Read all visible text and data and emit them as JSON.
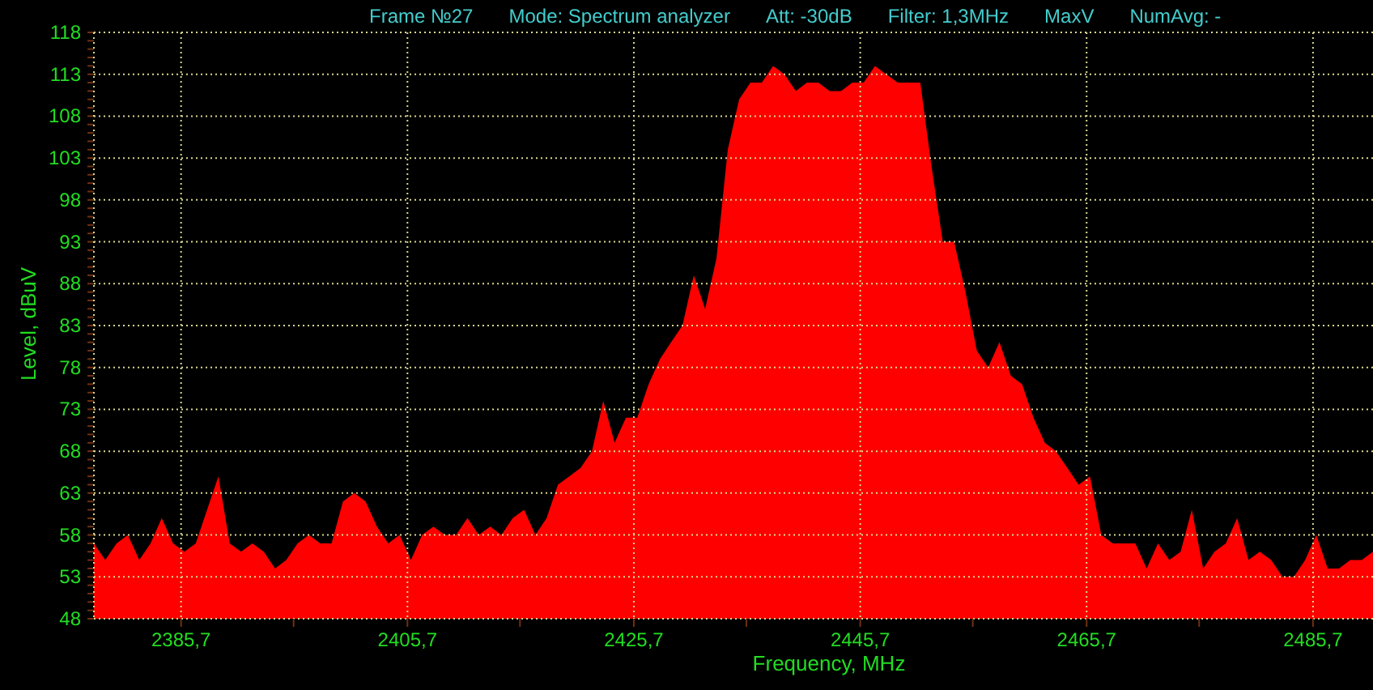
{
  "header": [
    {
      "text": "Frame №27"
    },
    {
      "text": "Mode: Spectrum analyzer"
    },
    {
      "text": "Att: -30dB"
    },
    {
      "text": "Filter: 1,3MHz"
    },
    {
      "text": "MaxV"
    },
    {
      "text": "NumAvg: -"
    }
  ],
  "chart_data": {
    "type": "area",
    "xlabel": "Frequency, MHz",
    "ylabel": "Level, dBuV",
    "grid": true,
    "xlim": [
      2378,
      2491
    ],
    "ylim": [
      48,
      118
    ],
    "xticks": [
      {
        "value": 2385.7,
        "label": "2385,7"
      },
      {
        "value": 2405.7,
        "label": "2405,7"
      },
      {
        "value": 2425.7,
        "label": "2425,7"
      },
      {
        "value": 2445.7,
        "label": "2445,7"
      },
      {
        "value": 2465.7,
        "label": "2465,7"
      },
      {
        "value": 2485.7,
        "label": "2485,7"
      }
    ],
    "yticks": [
      48,
      53,
      58,
      63,
      68,
      73,
      78,
      83,
      88,
      93,
      98,
      103,
      108,
      113,
      118
    ],
    "x": [
      2378,
      2379,
      2380,
      2381,
      2382,
      2383,
      2384,
      2385,
      2386,
      2387,
      2388,
      2389,
      2390,
      2391,
      2392,
      2393,
      2394,
      2395,
      2396,
      2397,
      2398,
      2399,
      2400,
      2401,
      2402,
      2403,
      2404,
      2405,
      2406,
      2407,
      2408,
      2409,
      2410,
      2411,
      2412,
      2413,
      2414,
      2415,
      2416,
      2417,
      2418,
      2419,
      2420,
      2421,
      2422,
      2423,
      2424,
      2425,
      2426,
      2427,
      2428,
      2429,
      2430,
      2431,
      2432,
      2433,
      2434,
      2435,
      2436,
      2437,
      2438,
      2439,
      2440,
      2441,
      2442,
      2443,
      2444,
      2445,
      2446,
      2447,
      2448,
      2449,
      2450,
      2451,
      2452,
      2453,
      2454,
      2455,
      2456,
      2457,
      2458,
      2459,
      2460,
      2461,
      2462,
      2463,
      2464,
      2465,
      2466,
      2467,
      2468,
      2469,
      2470,
      2471,
      2472,
      2473,
      2474,
      2475,
      2476,
      2477,
      2478,
      2479,
      2480,
      2481,
      2482,
      2483,
      2484,
      2485,
      2486,
      2487,
      2488,
      2489,
      2490,
      2491
    ],
    "series": [
      {
        "color": "#ff0000",
        "values": [
          57,
          55,
          57,
          58,
          55,
          57,
          60,
          57,
          56,
          57,
          61,
          65,
          57,
          56,
          57,
          56,
          54,
          55,
          57,
          58,
          57,
          57,
          62,
          63,
          62,
          59,
          57,
          58,
          55,
          58,
          59,
          58,
          58,
          60,
          58,
          59,
          58,
          60,
          61,
          58,
          60,
          64,
          65,
          66,
          68,
          74,
          69,
          72,
          72,
          76,
          79,
          81,
          83,
          89,
          85,
          91,
          104,
          110,
          112,
          112,
          114,
          113,
          111,
          112,
          112,
          111,
          111,
          112,
          112,
          114,
          113,
          112,
          112,
          112,
          102,
          93,
          93,
          87,
          80,
          78,
          81,
          77,
          76,
          72,
          69,
          68,
          66,
          64,
          65,
          58,
          57,
          57,
          57,
          54,
          57,
          55,
          56,
          61,
          54,
          56,
          57,
          60,
          55,
          56,
          55,
          53,
          53,
          55,
          58,
          54,
          54,
          55,
          55,
          56
        ]
      }
    ]
  }
}
